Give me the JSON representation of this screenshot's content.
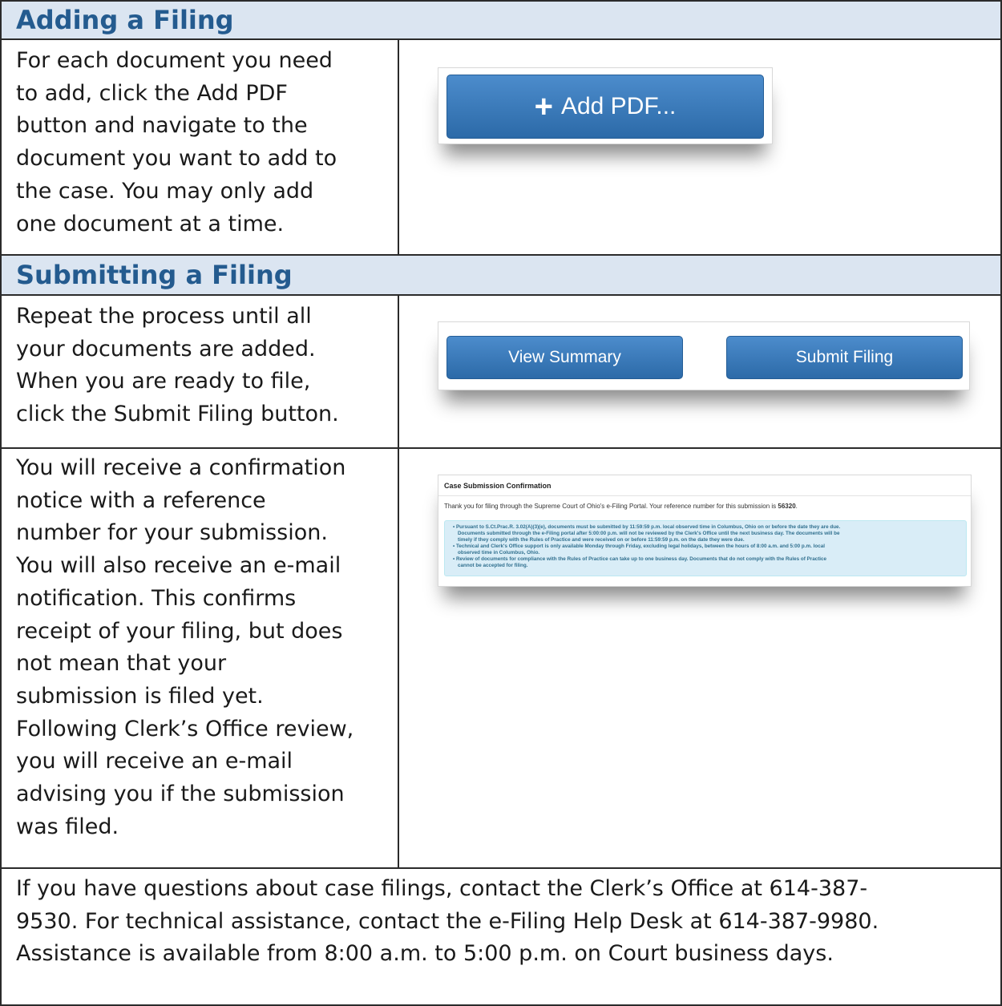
{
  "sections": {
    "adding_title": "Adding a Filing",
    "submitting_title": "Submitting a Filing"
  },
  "adding": {
    "lines": [
      "For each document you need",
      "to add, click the Add PDF",
      "button and navigate to the",
      "document you want to add to",
      "the case. You may only add",
      "one document at a time."
    ],
    "button_label": "Add PDF..."
  },
  "submitting": {
    "lines": [
      "Repeat the process until all",
      "your documents are added.",
      "When you are ready to file,",
      "click the Submit Filing button."
    ],
    "view_summary_label": "View Summary",
    "submit_filing_label": "Submit Filing"
  },
  "confirmation": {
    "lines": [
      "You will receive a confirmation",
      "notice with a reference",
      "number for your submission.",
      "You will also receive an e-mail",
      "notification. This confirms",
      "receipt of your filing, but does",
      "not mean that your",
      "submission is filed yet.",
      "Following Clerk’s Office review,",
      "you will receive an e-mail",
      "advising you if the submission",
      "was filed."
    ],
    "panel": {
      "title": "Case Submission Confirmation",
      "thanks_prefix": "Thank you for filing through the Supreme Court of Ohio's e-Filing Portal. Your reference number for this submission is ",
      "reference_number": "56320",
      "thanks_suffix": ".",
      "notes": [
        "• Pursuant to S.Ct.Prac.R. 3.02(A)(3)(e), documents must be submitted by 11:59:59 p.m. local observed time in Columbus, Ohio on or before the date they are due.",
        "Documents submitted through the e-Filing portal after 5:00:00 p.m. will not be reviewed by the Clerk's Office until the next business day. The documents will be",
        "timely if they comply with the Rules of Practice and were received on or before 11:59:59 p.m. on the date they were due.",
        "• Technical and Clerk's Office support is only available Monday through Friday, excluding legal holidays, between the hours of 8:00 a.m. and 5:00 p.m. local",
        "observed time in Columbus, Ohio.",
        "• Review of documents for compliance with the Rules of Practice can take up to one business day. Documents that do not comply with the Rules of Practice",
        "cannot be accepted for filing."
      ]
    }
  },
  "contact": {
    "lines": [
      "If you have questions about case filings, contact the Clerk’s Office at 614-387-",
      "9530.  For technical assistance, contact the e-Filing Help Desk at 614-387-9980.",
      "Assistance is available from 8:00 a.m. to 5:00 p.m. on Court business days."
    ]
  }
}
